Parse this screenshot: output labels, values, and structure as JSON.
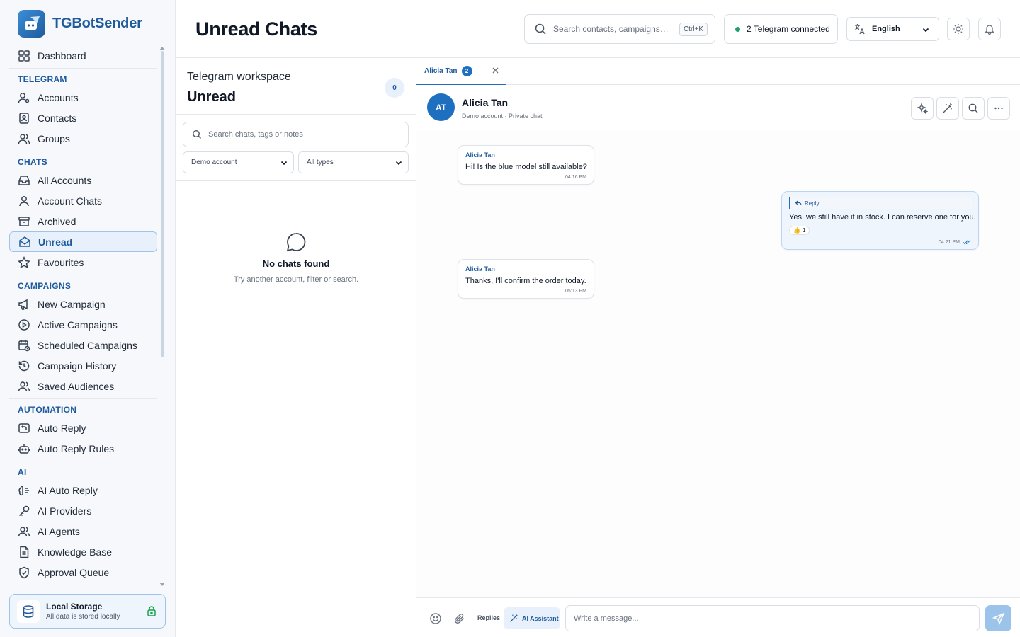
{
  "app": {
    "name": "TGBotSender"
  },
  "header": {
    "title": "Unread Chats",
    "search_placeholder": "Search contacts, campaigns, t...",
    "search_shortcut": "Ctrl+K",
    "telegram_status": "2 Telegram connected",
    "language": "English"
  },
  "sidebar": {
    "dashboard": "Dashboard",
    "sections": {
      "telegram": "TELEGRAM",
      "chats": "CHATS",
      "campaigns": "CAMPAIGNS",
      "automation": "AUTOMATION",
      "ai": "AI"
    },
    "items": {
      "accounts": "Accounts",
      "contacts": "Contacts",
      "groups": "Groups",
      "all_accounts": "All Accounts",
      "account_chats": "Account Chats",
      "archived": "Archived",
      "unread": "Unread",
      "favourites": "Favourites",
      "new_campaign": "New Campaign",
      "active_campaigns": "Active Campaigns",
      "scheduled_campaigns": "Scheduled Campaigns",
      "campaign_history": "Campaign History",
      "saved_audiences": "Saved Audiences",
      "auto_reply": "Auto Reply",
      "auto_reply_rules": "Auto Reply Rules",
      "ai_auto_reply": "AI Auto Reply",
      "ai_providers": "AI Providers",
      "ai_agents": "AI Agents",
      "knowledge_base": "Knowledge Base",
      "approval_queue": "Approval Queue"
    },
    "active_item": "Unread",
    "storage": {
      "title": "Local Storage",
      "subtitle": "All data is stored locally"
    }
  },
  "list_panel": {
    "subtitle": "Telegram workspace",
    "title": "Unread",
    "count": "0",
    "search_placeholder": "Search chats, tags or notes",
    "account_filter": "Demo account",
    "type_filter": "All types",
    "empty_title": "No chats found",
    "empty_subtitle": "Try another account, filter or search."
  },
  "chat": {
    "tab": {
      "label": "Alicia Tan",
      "badge": "2"
    },
    "contact": {
      "initials": "AT",
      "name": "Alicia Tan",
      "meta": "Demo account · Private chat"
    },
    "messages": [
      {
        "direction": "in",
        "author": "Alicia Tan",
        "text": "Hi! Is the blue model still available?",
        "time": "04:16 PM"
      },
      {
        "direction": "out",
        "reply_label": "Reply",
        "text": "Yes, we still have it in stock. I can reserve one for you.",
        "reaction": "👍",
        "reaction_count": "1",
        "time": "04:21 PM"
      },
      {
        "direction": "in",
        "author": "Alicia Tan",
        "text": "Thanks, I'll confirm the order today.",
        "time": "05:13 PM"
      }
    ],
    "composer": {
      "replies_label": "Replies",
      "ai_label": "AI Assistant",
      "placeholder": "Write a message..."
    }
  },
  "colors": {
    "accent": "#1e6fbf",
    "brand": "#1e5a9c",
    "online": "#22a06b",
    "active_bg": "#e8f1fb"
  }
}
